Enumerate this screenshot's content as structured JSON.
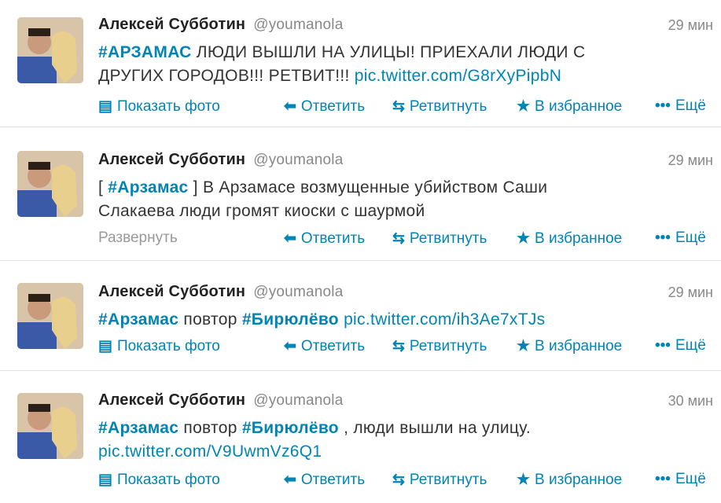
{
  "accent_color": "#0084b4",
  "actions": {
    "show_photo": "Показать фото",
    "expand": "Развернуть",
    "reply": "Ответить",
    "retweet": "Ретвитнуть",
    "favorite": "В избранное",
    "more": "Ещё"
  },
  "icons": {
    "photo": "photo-icon",
    "reply": "reply-arrow-icon",
    "retweet": "retweet-icon",
    "favorite": "star-icon",
    "more": "ellipsis-icon"
  },
  "tweets": [
    {
      "author": "Алексей Субботин",
      "handle": "@youmanola",
      "time": "29 мин",
      "line1_tag": "#АРЗАМАС",
      "line1_rest": " ЛЮДИ ВЫШЛИ НА УЛИЦЫ! ПРИЕХАЛИ ЛЮДИ С",
      "line2_text": "ДРУГИХ ГОРОДОВ!!! РЕТВИТ!!! ",
      "line2_link": "pic.twitter.com/G8rXyPipbN"
    },
    {
      "author": "Алексей Субботин",
      "handle": "@youmanola",
      "time": "29 мин",
      "line1_pre": "[ ",
      "line1_tag": "#Арзамас",
      "line1_rest": " ] В Арзамасе возмущенные убийством Саши",
      "line2_text": "Слакаева люди громят киоски с шаурмой"
    },
    {
      "author": "Алексей Субботин",
      "handle": "@youmanola",
      "time": "29 мин",
      "line1_tag": "#Арзамас",
      "line1_mid": " повтор ",
      "line1_tag2": "#Бирюлёво",
      "line1_link": " pic.twitter.com/ih3Ae7xTJs"
    },
    {
      "author": "Алексей Субботин",
      "handle": "@youmanola",
      "time": "30 мин",
      "line1_tag": "#Арзамас",
      "line1_mid": " повтор ",
      "line1_tag2": "#Бирюлёво",
      "line1_rest": " , люди вышли на улицу.",
      "line2_link": "pic.twitter.com/V9UwmVz6Q1"
    }
  ]
}
